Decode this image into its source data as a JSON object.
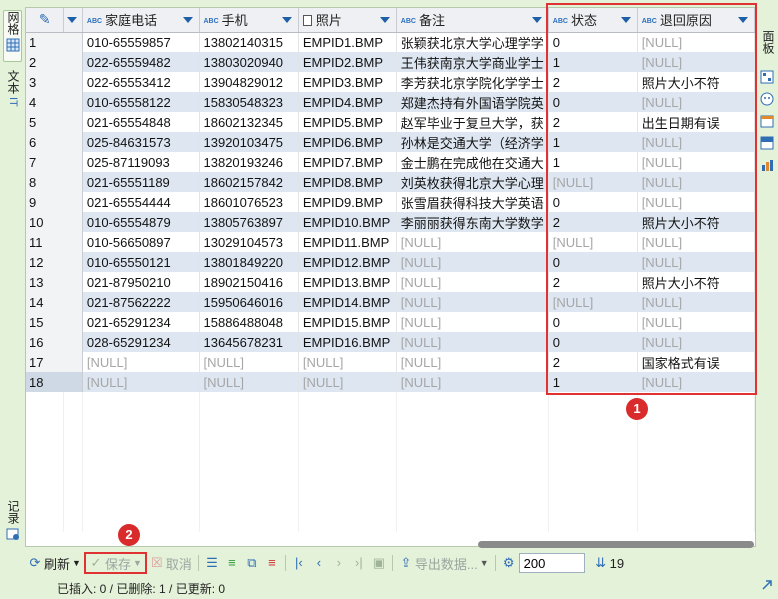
{
  "left_tabs": [
    {
      "label": "网格",
      "icon": "grid-icon"
    },
    {
      "label": "文本",
      "icon": "text-icon"
    },
    {
      "label": "记录",
      "icon": "record-icon"
    }
  ],
  "right_tabs": [
    {
      "label": "面板"
    }
  ],
  "columns": [
    {
      "label": "家庭电话",
      "type": "abc"
    },
    {
      "label": "手机",
      "type": "abc"
    },
    {
      "label": "照片",
      "type": "doc"
    },
    {
      "label": "备注",
      "type": "abc"
    },
    {
      "label": "状态",
      "type": "abc"
    },
    {
      "label": "退回原因",
      "type": "abc"
    }
  ],
  "rows": [
    [
      "1",
      "010-65559857",
      "13802140315",
      "EMPID1.BMP",
      "张颖获北京大学心理学学",
      "0",
      "[NULL]"
    ],
    [
      "2",
      "022-65559482",
      "13803020940",
      "EMPID2.BMP",
      "王伟获南京大学商业学士",
      "1",
      "[NULL]"
    ],
    [
      "3",
      "022-65553412",
      "13904829012",
      "EMPID3.BMP",
      "李芳获北京学院化学学士",
      "2",
      "照片大小不符"
    ],
    [
      "4",
      "010-65558122",
      "15830548323",
      "EMPID4.BMP",
      "郑建杰持有外国语学院英",
      "0",
      "[NULL]"
    ],
    [
      "5",
      "021-65554848",
      "18602132345",
      "EMPID5.BMP",
      "赵军毕业于复旦大学，获",
      "2",
      "出生日期有误"
    ],
    [
      "6",
      "025-84631573",
      "13920103475",
      "EMPID6.BMP",
      "孙林是交通大学（经济学",
      "1",
      "[NULL]"
    ],
    [
      "7",
      "025-87119093",
      "13820193246",
      "EMPID7.BMP",
      "金士鹏在完成他在交通大",
      "1",
      "[NULL]"
    ],
    [
      "8",
      "021-65551189",
      "18602157842",
      "EMPID8.BMP",
      "刘英枚获得北京大学心理",
      "[NULL]",
      "[NULL]"
    ],
    [
      "9",
      "021-65554444",
      "18601076523",
      "EMPID9.BMP",
      "张雪眉获得科技大学英语",
      "0",
      "[NULL]"
    ],
    [
      "10",
      "010-65554879",
      "13805763897",
      "EMPID10.BMP",
      "李丽丽获得东南大学数学",
      "2",
      "照片大小不符"
    ],
    [
      "11",
      "010-56650897",
      "13029104573",
      "EMPID11.BMP",
      "[NULL]",
      "[NULL]",
      "[NULL]"
    ],
    [
      "12",
      "010-65550121",
      "13801849220",
      "EMPID12.BMP",
      "[NULL]",
      "0",
      "[NULL]"
    ],
    [
      "13",
      "021-87950210",
      "18902150416",
      "EMPID13.BMP",
      "[NULL]",
      "2",
      "照片大小不符"
    ],
    [
      "14",
      "021-87562222",
      "15950646016",
      "EMPID14.BMP",
      "[NULL]",
      "[NULL]",
      "[NULL]"
    ],
    [
      "15",
      "021-65291234",
      "15886488048",
      "EMPID15.BMP",
      "[NULL]",
      "0",
      "[NULL]"
    ],
    [
      "16",
      "028-65291234",
      "13645678231",
      "EMPID16.BMP",
      "[NULL]",
      "0",
      "[NULL]"
    ],
    [
      "17",
      "[NULL]",
      "[NULL]",
      "[NULL]",
      "[NULL]",
      "2",
      "国家格式有误"
    ],
    [
      "18",
      "[NULL]",
      "[NULL]",
      "[NULL]",
      "[NULL]",
      "1",
      "[NULL]"
    ]
  ],
  "toolbar": {
    "refresh_label": "刷新",
    "save_label": "保存",
    "cancel_label": "取消",
    "export_label": "导出数据...",
    "fetch_size": "200",
    "row_count": "19"
  },
  "status_text": "已插入: 0 / 已删除: 1 / 已更新: 0",
  "callouts": [
    "1",
    "2"
  ],
  "colors": {
    "accent": "#2f6db5",
    "highlight": "#e03232",
    "row_alt": "#dde6f1",
    "panel_bg": "#e4f2d9"
  }
}
